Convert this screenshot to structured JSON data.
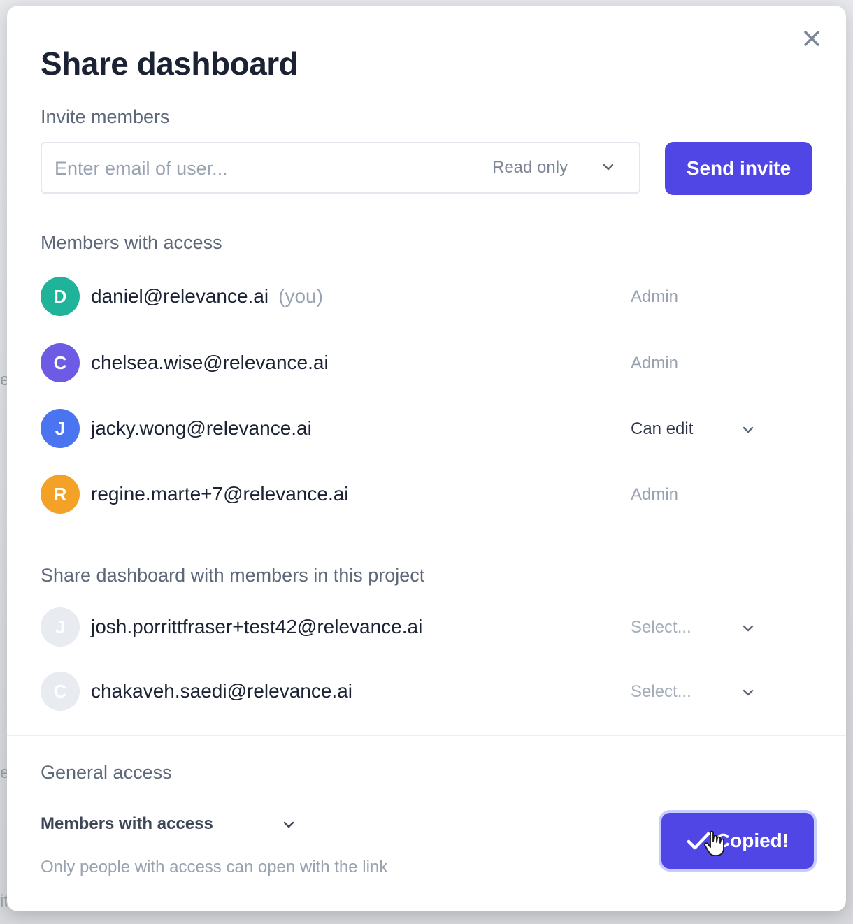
{
  "dialog": {
    "title": "Share dashboard",
    "close_icon": "close-icon"
  },
  "invite": {
    "section_label": "Invite members",
    "email_placeholder": "Enter email of user...",
    "role_selected": "Read only",
    "send_label": "Send invite"
  },
  "members": {
    "section_label": "Members with access",
    "items": [
      {
        "initial": "D",
        "email": "daniel@relevance.ai",
        "you_label": "(you)",
        "role": "Admin",
        "color": "#1fb39a"
      },
      {
        "initial": "C",
        "email": "chelsea.wise@relevance.ai",
        "role": "Admin",
        "color": "#6d5be6"
      },
      {
        "initial": "J",
        "email": "jacky.wong@relevance.ai",
        "role": "Can edit",
        "color": "#4a74f0"
      },
      {
        "initial": "R",
        "email": "regine.marte+7@relevance.ai",
        "role": "Admin",
        "color": "#f3a127"
      }
    ]
  },
  "project_members": {
    "section_label": "Share dashboard with members in this project",
    "items": [
      {
        "initial": "J",
        "email": "josh.porrittfraser+test42@relevance.ai",
        "role_placeholder": "Select...",
        "color": "#e8ebf0"
      },
      {
        "initial": "C",
        "email": "chakaveh.saedi@relevance.ai",
        "role_placeholder": "Select...",
        "color": "#e8ebf0"
      }
    ]
  },
  "general_access": {
    "section_label": "General access",
    "selected": "Members with access",
    "description": "Only people with access can open with the link",
    "copy_button_label": "Copied!",
    "copy_icon": "check-icon"
  },
  "colors": {
    "primary": "#4f46e5",
    "title_text": "#1a2233",
    "muted_text": "#98a2b1"
  }
}
